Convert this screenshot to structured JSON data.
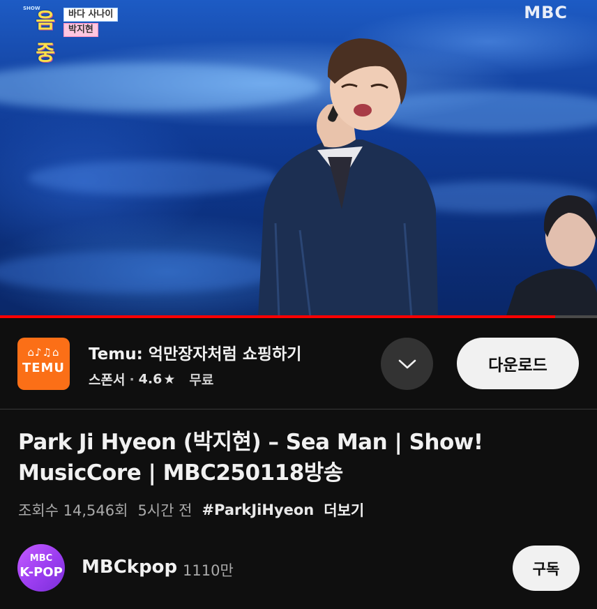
{
  "video": {
    "show_logo_vertical": "SHOW",
    "show_logo_mark": "음중",
    "caption_song": "바다 사나이",
    "caption_artist": "박지현",
    "broadcaster_logo": "MBC",
    "progress_fraction": 0.93,
    "progress_color": "#ff0000"
  },
  "ad": {
    "logo_icons": "⌂♪♫⌂",
    "logo_text": "TEMU",
    "logo_color": "#fb6f17",
    "title": "Temu: 억만장자처럼 쇼핑하기",
    "sponsor_label": "스폰서",
    "separator": "·",
    "rating": "4.6",
    "rating_icon": "★",
    "price": "무료",
    "expand_icon": "chevron-down-icon",
    "download_label": "다운로드"
  },
  "video_info": {
    "title": "Park Ji Hyeon (박지현) – Sea Man | Show! MusicCore | MBC250118방송",
    "views": "조회수 14,546회",
    "time_ago": "5시간 전",
    "hashtag": "#ParkJiHyeon",
    "more_label": "더보기"
  },
  "channel": {
    "avatar_top": "MBC",
    "avatar_bottom": "K-POP",
    "name": "MBCkpop",
    "subscribers": "1110만",
    "subscribe_label": "구독"
  }
}
